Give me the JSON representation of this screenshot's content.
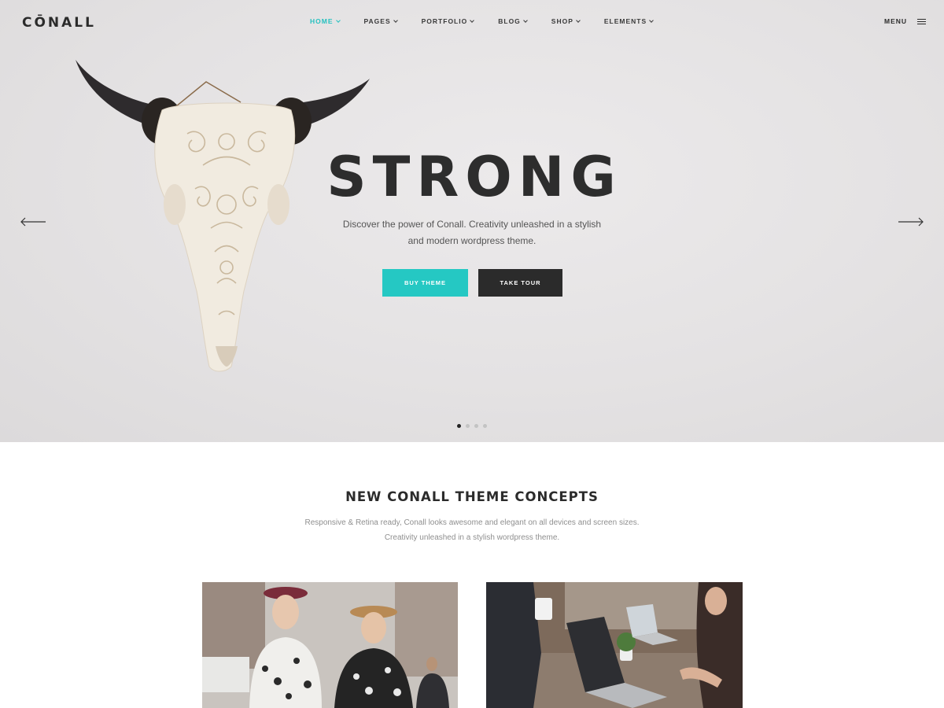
{
  "brand": {
    "logo": "CŌNALL"
  },
  "nav": {
    "items": [
      {
        "label": "HOME",
        "active": true
      },
      {
        "label": "PAGES",
        "active": false
      },
      {
        "label": "PORTFOLIO",
        "active": false
      },
      {
        "label": "BLOG",
        "active": false
      },
      {
        "label": "SHOP",
        "active": false
      },
      {
        "label": "ELEMENTS",
        "active": false
      }
    ],
    "menu_label": "MENU"
  },
  "hero": {
    "title": "STRONG",
    "subtitle_line1": "Discover the power of Conall. Creativity unleashed in a stylish",
    "subtitle_line2": "and modern wordpress theme.",
    "buy_label": "BUY THEME",
    "tour_label": "TAKE TOUR",
    "slide_count": 4,
    "active_slide": 1
  },
  "section": {
    "title": "NEW CONALL THEME CONCEPTS",
    "sub_line1": "Responsive & Retina ready, Conall looks awesome and elegant on all devices and screen sizes.",
    "sub_line2": "Creativity unleashed in a stylish wordpress theme."
  },
  "colors": {
    "accent": "#25c8c3",
    "dark": "#2b2b2b",
    "hero_bg": "#e4e2e3"
  },
  "icons": {
    "prev": "arrow-left-icon",
    "next": "arrow-right-icon",
    "menu": "hamburger-icon",
    "dropdown": "chevron-down-icon"
  }
}
